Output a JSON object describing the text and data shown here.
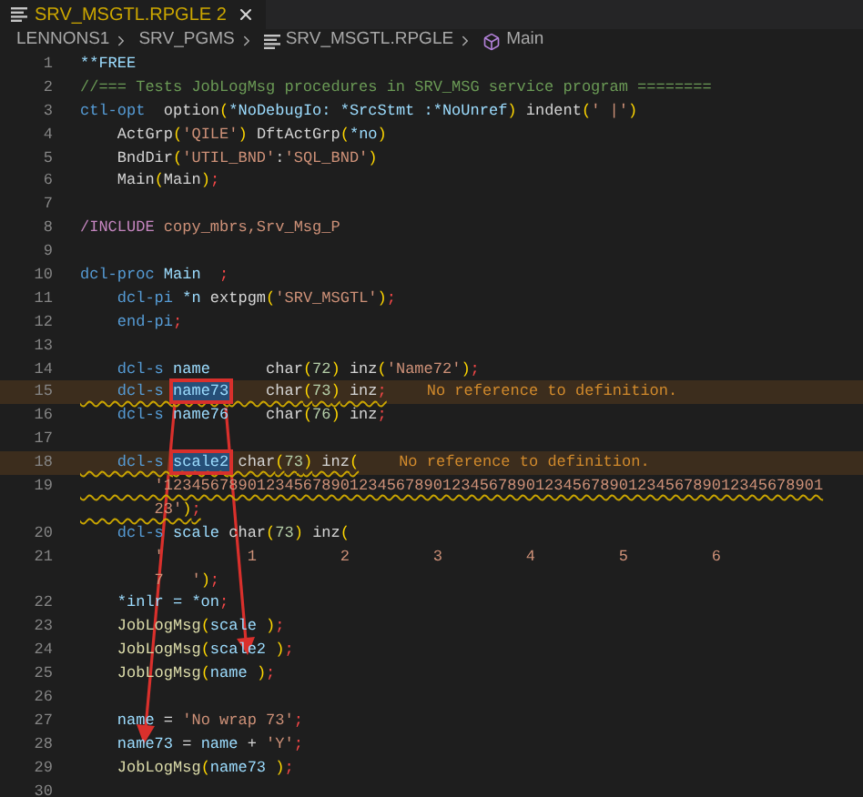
{
  "tab": {
    "title": "SRV_MSGTL.RPGLE",
    "problems": "2",
    "selected": true
  },
  "breadcrumb": [
    {
      "kind": "folder",
      "label": "LENNONS1"
    },
    {
      "kind": "folder",
      "label": "SRV_PGMS"
    },
    {
      "kind": "file",
      "label": "SRV_MSGTL.RPGLE"
    },
    {
      "kind": "symbol",
      "label": "Main"
    }
  ],
  "lines": [
    {
      "number": "1",
      "rows": [
        [
          {
            "kind": "var",
            "text": "**FREE"
          }
        ]
      ]
    },
    {
      "number": "2",
      "rows": [
        [
          {
            "kind": "com",
            "text": "//=== Tests JobLogMsg procedures in SRV_MSG service program ========"
          }
        ]
      ]
    },
    {
      "number": "3",
      "rows": [
        [
          {
            "kind": "kw",
            "text": "ctl-opt"
          },
          {
            "kind": "plain",
            "text": "  option"
          },
          {
            "kind": "br",
            "text": "("
          },
          {
            "kind": "var",
            "text": "*NoDebugIo: *SrcStmt :*NoUnref"
          },
          {
            "kind": "br",
            "text": ")"
          },
          {
            "kind": "plain",
            "text": " indent"
          },
          {
            "kind": "br",
            "text": "("
          },
          {
            "kind": "str",
            "text": "' |'"
          },
          {
            "kind": "br",
            "text": ")"
          }
        ]
      ]
    },
    {
      "number": "4",
      "rows": [
        [
          {
            "kind": "plain",
            "text": "    ActGrp"
          },
          {
            "kind": "br",
            "text": "("
          },
          {
            "kind": "str",
            "text": "'QILE'"
          },
          {
            "kind": "br",
            "text": ")"
          },
          {
            "kind": "plain",
            "text": " DftActGrp"
          },
          {
            "kind": "br",
            "text": "("
          },
          {
            "kind": "var",
            "text": "*no"
          },
          {
            "kind": "br",
            "text": ")"
          }
        ]
      ]
    },
    {
      "number": "5",
      "rows": [
        [
          {
            "kind": "plain",
            "text": "    BndDir"
          },
          {
            "kind": "br",
            "text": "("
          },
          {
            "kind": "str",
            "text": "'UTIL_BND'"
          },
          {
            "kind": "plain",
            "text": ":"
          },
          {
            "kind": "str",
            "text": "'SQL_BND'"
          },
          {
            "kind": "br",
            "text": ")"
          }
        ]
      ]
    },
    {
      "number": "6",
      "rows": [
        [
          {
            "kind": "plain",
            "text": "    Main"
          },
          {
            "kind": "br",
            "text": "("
          },
          {
            "kind": "plain",
            "text": "Main"
          },
          {
            "kind": "br",
            "text": ")"
          },
          {
            "kind": "semi",
            "text": ";"
          }
        ]
      ]
    },
    {
      "number": "7"
    },
    {
      "number": "8",
      "rows": [
        [
          {
            "kind": "dir",
            "text": "/INCLUDE"
          },
          {
            "kind": "str",
            "text": " copy_mbrs,Srv_Msg_P"
          }
        ]
      ]
    },
    {
      "number": "9"
    },
    {
      "number": "10",
      "rows": [
        [
          {
            "kind": "kw",
            "text": "dcl-proc"
          },
          {
            "kind": "var",
            "text": " Main  "
          },
          {
            "kind": "semi",
            "text": ";"
          }
        ]
      ]
    },
    {
      "number": "11",
      "rows": [
        [
          {
            "kind": "kw",
            "text": "    dcl-pi"
          },
          {
            "kind": "var",
            "text": " *n"
          },
          {
            "kind": "plain",
            "text": " extpgm"
          },
          {
            "kind": "br",
            "text": "("
          },
          {
            "kind": "str",
            "text": "'SRV_MSGTL'"
          },
          {
            "kind": "br",
            "text": ")"
          },
          {
            "kind": "semi",
            "text": ";"
          }
        ]
      ]
    },
    {
      "number": "12",
      "rows": [
        [
          {
            "kind": "kw",
            "text": "    end-pi"
          },
          {
            "kind": "semi",
            "text": ";"
          }
        ]
      ]
    },
    {
      "number": "13"
    },
    {
      "number": "14",
      "rows": [
        [
          {
            "kind": "kw",
            "text": "    dcl-s"
          },
          {
            "kind": "var",
            "text": " name      "
          },
          {
            "kind": "plain",
            "text": "char"
          },
          {
            "kind": "br",
            "text": "("
          },
          {
            "kind": "num",
            "text": "72"
          },
          {
            "kind": "br",
            "text": ")"
          },
          {
            "kind": "plain",
            "text": " inz"
          },
          {
            "kind": "br",
            "text": "("
          },
          {
            "kind": "str",
            "text": "'Name72'"
          },
          {
            "kind": "br",
            "text": ")"
          },
          {
            "kind": "semi",
            "text": ";"
          }
        ]
      ]
    },
    {
      "number": "15",
      "warning": true,
      "squiggly": true,
      "message": "No reference to definition.",
      "rows": [
        [
          {
            "kind": "kw",
            "text": "    dcl-s "
          },
          {
            "kind": "var",
            "text": "name73",
            "boxed": true
          },
          {
            "kind": "plain",
            "text": "    char"
          },
          {
            "kind": "br",
            "text": "("
          },
          {
            "kind": "num",
            "text": "73"
          },
          {
            "kind": "br",
            "text": ")"
          },
          {
            "kind": "plain",
            "text": " inz"
          },
          {
            "kind": "semi",
            "text": ";"
          }
        ]
      ]
    },
    {
      "number": "16",
      "rows": [
        [
          {
            "kind": "kw",
            "text": "    dcl-s"
          },
          {
            "kind": "var",
            "text": " name76    "
          },
          {
            "kind": "plain",
            "text": "char"
          },
          {
            "kind": "br",
            "text": "("
          },
          {
            "kind": "num",
            "text": "76"
          },
          {
            "kind": "br",
            "text": ")"
          },
          {
            "kind": "plain",
            "text": " inz"
          },
          {
            "kind": "semi",
            "text": ";"
          }
        ]
      ]
    },
    {
      "number": "17"
    },
    {
      "number": "18",
      "warning": true,
      "squiggly": true,
      "message": "No reference to definition.",
      "rows": [
        [
          {
            "kind": "kw",
            "text": "    dcl-s "
          },
          {
            "kind": "var",
            "text": "scale2",
            "boxed": true
          },
          {
            "kind": "plain",
            "text": " char"
          },
          {
            "kind": "br",
            "text": "("
          },
          {
            "kind": "num",
            "text": "73"
          },
          {
            "kind": "br",
            "text": ")"
          },
          {
            "kind": "plain",
            "text": " inz"
          },
          {
            "kind": "br",
            "text": "("
          }
        ]
      ]
    },
    {
      "number": "19",
      "squiggly": true,
      "rows": [
        [
          {
            "kind": "str",
            "text": "        '12345678901234567890123456789012345678901234567890123456789012345678901"
          }
        ],
        [
          {
            "kind": "str",
            "text": "        23'"
          },
          {
            "kind": "br",
            "text": ")"
          },
          {
            "kind": "semi",
            "text": ";"
          }
        ]
      ]
    },
    {
      "number": "20",
      "rows": [
        [
          {
            "kind": "kw",
            "text": "    dcl-s"
          },
          {
            "kind": "var",
            "text": " scale"
          },
          {
            "kind": "plain",
            "text": " char"
          },
          {
            "kind": "br",
            "text": "("
          },
          {
            "kind": "num",
            "text": "73"
          },
          {
            "kind": "br",
            "text": ")"
          },
          {
            "kind": "plain",
            "text": " inz"
          },
          {
            "kind": "br",
            "text": "("
          }
        ]
      ]
    },
    {
      "number": "21",
      "rows": [
        [
          {
            "kind": "str",
            "text": "        '         1         2         3         4         5         6"
          }
        ],
        [
          {
            "kind": "str",
            "text": "        7   '"
          },
          {
            "kind": "br",
            "text": ")"
          },
          {
            "kind": "semi",
            "text": ";"
          }
        ]
      ]
    },
    {
      "number": "22",
      "rows": [
        [
          {
            "kind": "var",
            "text": "    *inlr = *on"
          },
          {
            "kind": "semi",
            "text": ";"
          }
        ]
      ]
    },
    {
      "number": "23",
      "rows": [
        [
          {
            "kind": "fn",
            "text": "    JobLogMsg"
          },
          {
            "kind": "br",
            "text": "("
          },
          {
            "kind": "var",
            "text": "scale "
          },
          {
            "kind": "br",
            "text": ")"
          },
          {
            "kind": "semi",
            "text": ";"
          }
        ]
      ]
    },
    {
      "number": "24",
      "rows": [
        [
          {
            "kind": "fn",
            "text": "    JobLogMsg"
          },
          {
            "kind": "br",
            "text": "("
          },
          {
            "kind": "var",
            "text": "scale2 "
          },
          {
            "kind": "br",
            "text": ")"
          },
          {
            "kind": "semi",
            "text": ";"
          }
        ]
      ]
    },
    {
      "number": "25",
      "rows": [
        [
          {
            "kind": "fn",
            "text": "    JobLogMsg"
          },
          {
            "kind": "br",
            "text": "("
          },
          {
            "kind": "var",
            "text": "name "
          },
          {
            "kind": "br",
            "text": ")"
          },
          {
            "kind": "semi",
            "text": ";"
          }
        ]
      ]
    },
    {
      "number": "26"
    },
    {
      "number": "27",
      "rows": [
        [
          {
            "kind": "var",
            "text": "    name"
          },
          {
            "kind": "plain",
            "text": " = "
          },
          {
            "kind": "str",
            "text": "'No wrap 73'"
          },
          {
            "kind": "semi",
            "text": ";"
          }
        ]
      ]
    },
    {
      "number": "28",
      "rows": [
        [
          {
            "kind": "var",
            "text": "    name73"
          },
          {
            "kind": "plain",
            "text": " = "
          },
          {
            "kind": "var",
            "text": "name"
          },
          {
            "kind": "plain",
            "text": " + "
          },
          {
            "kind": "str",
            "text": "'Y'"
          },
          {
            "kind": "semi",
            "text": ";"
          }
        ]
      ]
    },
    {
      "number": "29",
      "rows": [
        [
          {
            "kind": "fn",
            "text": "    JobLogMsg"
          },
          {
            "kind": "br",
            "text": "("
          },
          {
            "kind": "var",
            "text": "name73 "
          },
          {
            "kind": "br",
            "text": ")"
          },
          {
            "kind": "semi",
            "text": ";"
          }
        ]
      ]
    },
    {
      "number": "30"
    }
  ]
}
